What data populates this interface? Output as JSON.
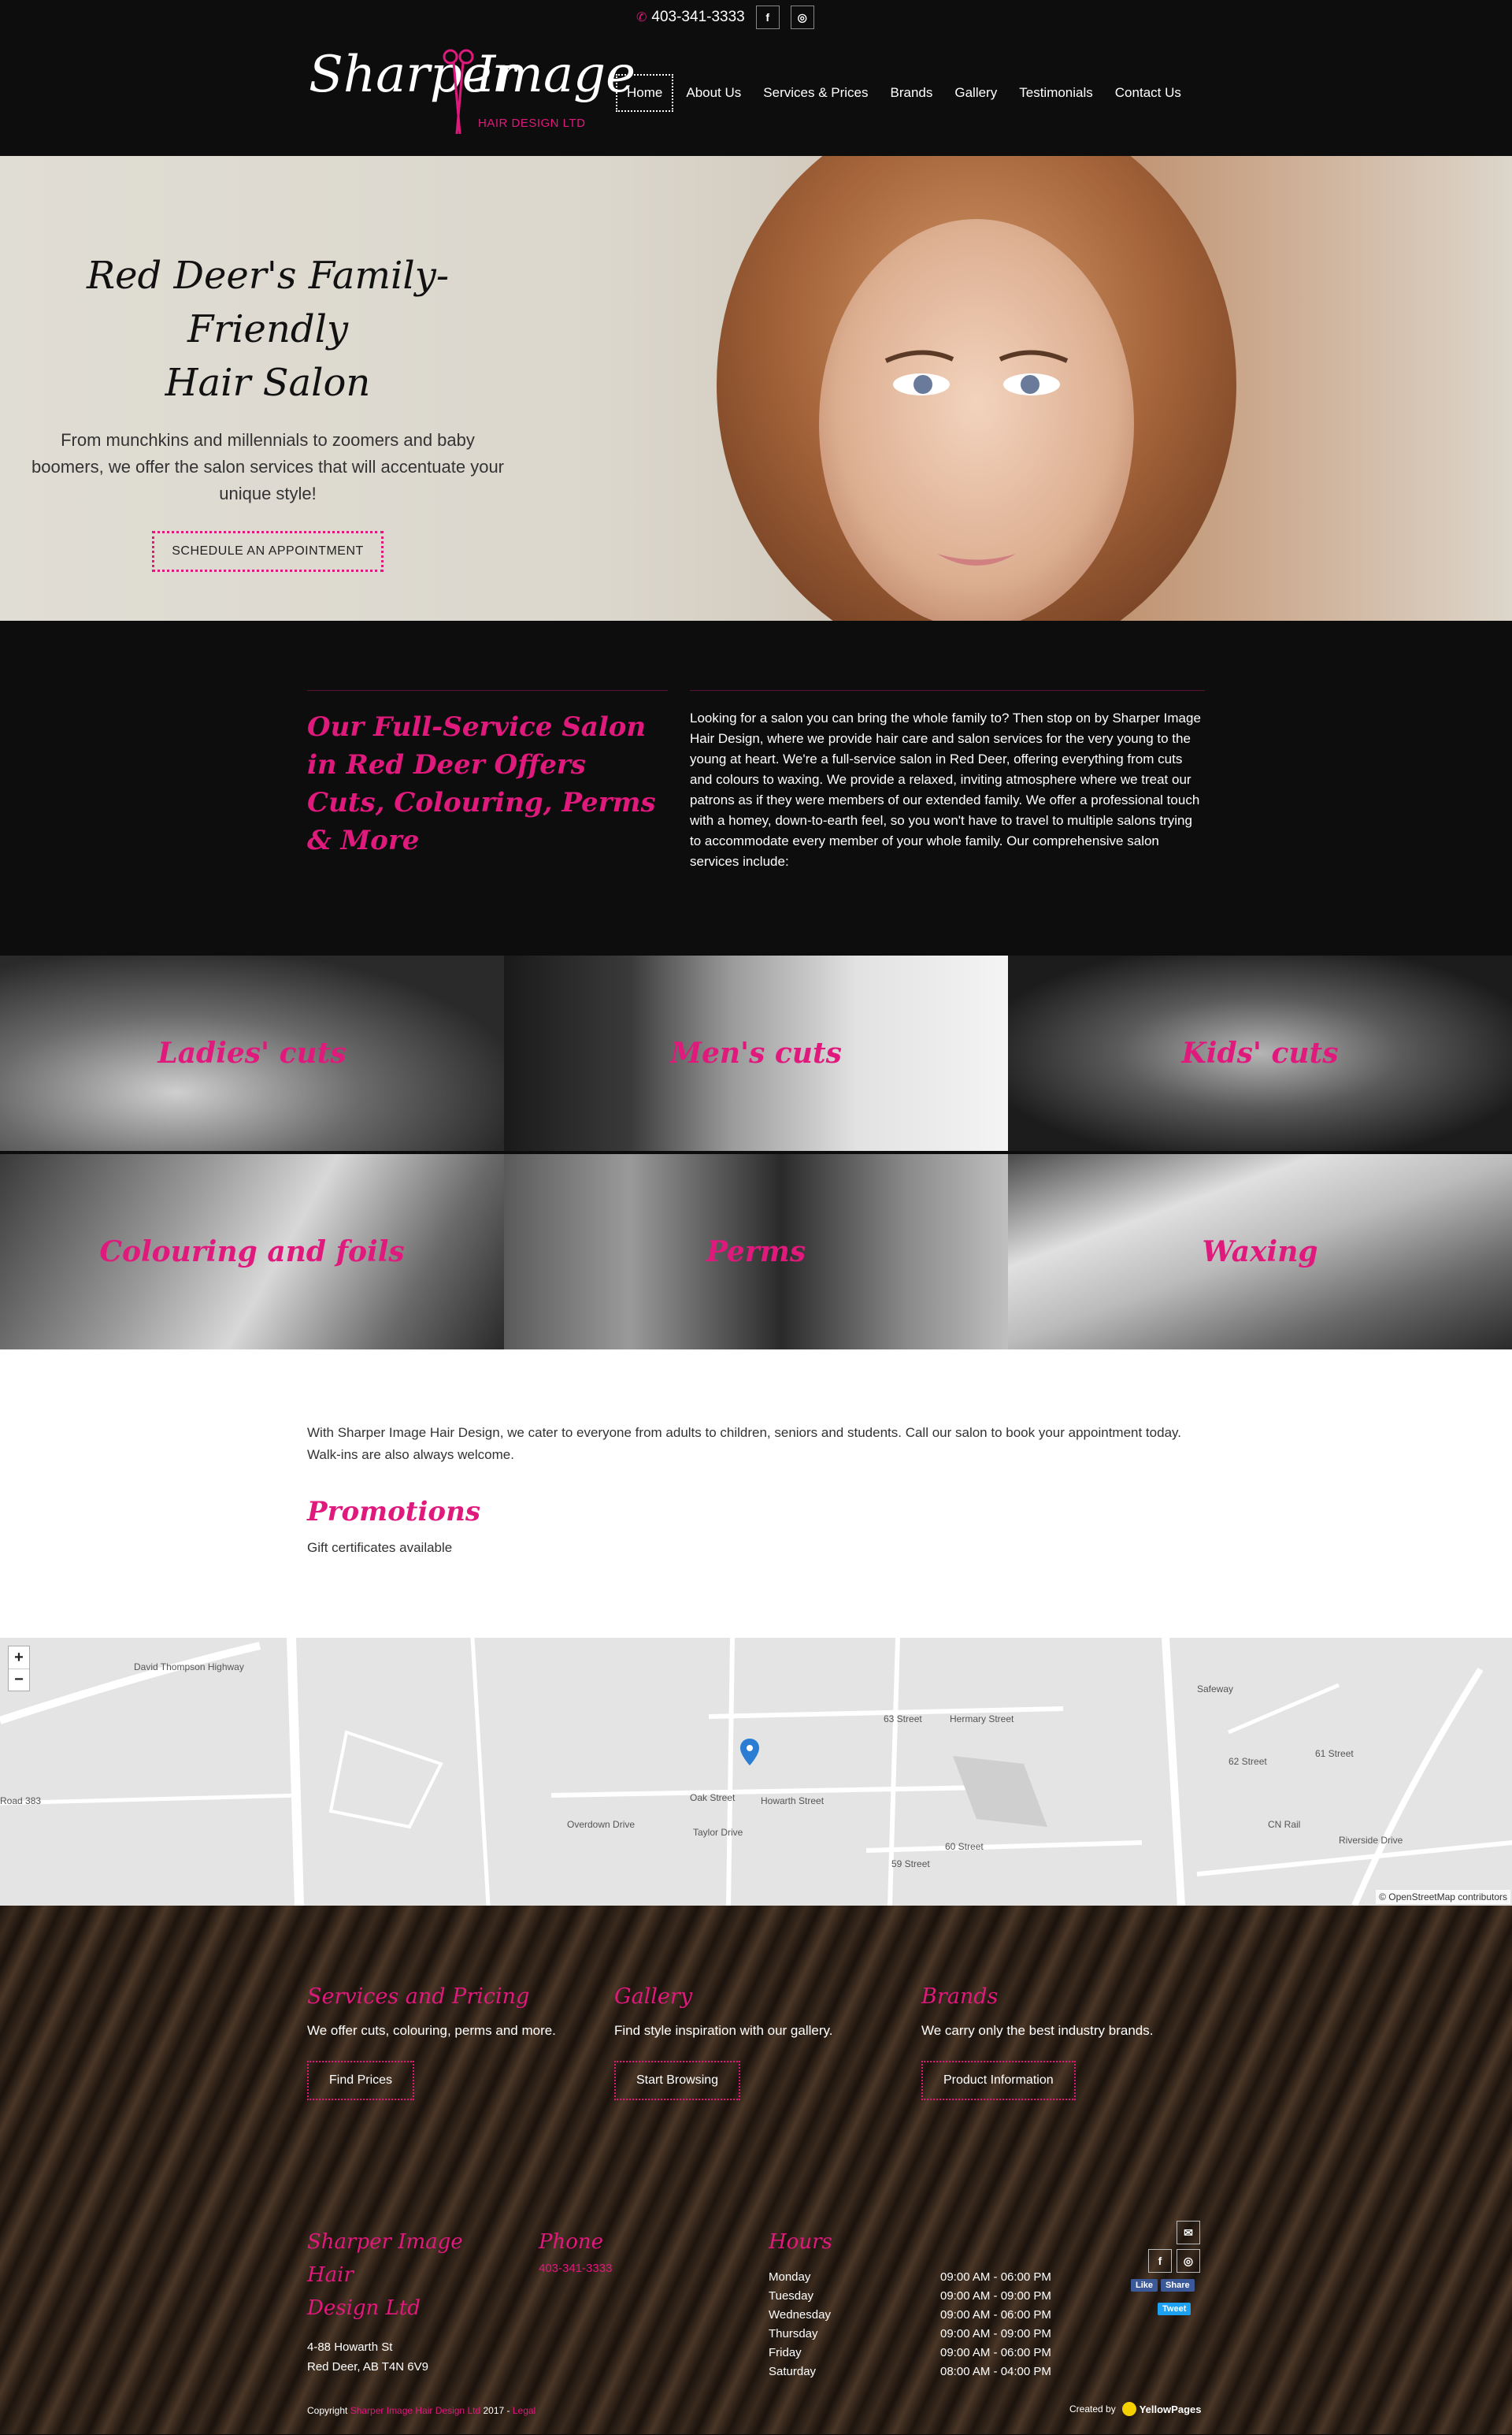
{
  "header": {
    "phone": "403-341-3333",
    "social": [
      "f",
      "◎"
    ],
    "logo_word_left": "Sharper",
    "logo_word_right": "Image",
    "logo_sub": "HAIR DESIGN LTD",
    "nav": [
      {
        "label": "Home",
        "active": true
      },
      {
        "label": "About Us"
      },
      {
        "label": "Services & Prices"
      },
      {
        "label": "Brands"
      },
      {
        "label": "Gallery"
      },
      {
        "label": "Testimonials"
      },
      {
        "label": "Contact Us"
      }
    ]
  },
  "hero": {
    "title_line1": "Red Deer's Family-Friendly",
    "title_line2": "Hair Salon",
    "subtitle": "From munchkins and millennials to zoomers and baby boomers, we offer the salon services that will accentuate your unique style!",
    "button": "SCHEDULE AN APPOINTMENT"
  },
  "intro": {
    "heading": "Our Full-Service Salon in Red Deer Offers Cuts, Colouring, Perms & More",
    "body": "Looking for a salon you can bring the whole family to? Then stop on by Sharper Image Hair Design, where we provide hair care and salon services for the very young to the young at heart. We're a full-service salon in Red Deer, offering everything from cuts and colours to waxing. We provide a relaxed, inviting atmosphere where we treat our patrons as if they were members of our extended family. We offer a professional touch with a homey, down-to-earth feel, so you won't have to travel to multiple salons trying to accommodate every member of your whole family. Our comprehensive salon services include:"
  },
  "services": [
    {
      "label": "Ladies' cuts"
    },
    {
      "label": "Men's cuts"
    },
    {
      "label": "Kids' cuts"
    },
    {
      "label": "Colouring and foils"
    },
    {
      "label": "Perms"
    },
    {
      "label": "Waxing"
    }
  ],
  "info": {
    "paragraph": "With Sharper Image Hair Design, we cater to everyone from adults to children, seniors and students. Call our salon to book your appointment today. Walk-ins are also always welcome.",
    "promotions_heading": "Promotions",
    "promotions_text": "Gift certificates available"
  },
  "map": {
    "zoom_in": "+",
    "zoom_out": "−",
    "attribution": "© OpenStreetMap contributors",
    "labels": [
      "Oak Street",
      "Howarth Street",
      "63 Street",
      "Hermary Street",
      "60 Street",
      "59 Street",
      "Taylor Drive",
      "Overdown Drive",
      "Road 383",
      "David Thompson Highway",
      "Safeway",
      "CN Rail",
      "Riverside Drive",
      "62 Street",
      "61 Street"
    ]
  },
  "cta": [
    {
      "title": "Services and Pricing",
      "text": "We offer cuts, colouring, perms and more.",
      "button": "Find Prices"
    },
    {
      "title": "Gallery",
      "text": "Find style inspiration with our gallery.",
      "button": "Start Browsing"
    },
    {
      "title": "Brands",
      "text": "We carry only the best industry brands.",
      "button": "Product Information"
    }
  ],
  "contact": {
    "name_line1": "Sharper Image Hair",
    "name_line2": "Design Ltd",
    "address_line1": "4-88 Howarth St",
    "address_line2": "Red Deer, AB T4N 6V9",
    "phone_heading": "Phone",
    "phone": "403-341-3333",
    "hours_heading": "Hours",
    "hours": [
      {
        "day": "Monday",
        "time": "09:00 AM - 06:00 PM"
      },
      {
        "day": "Tuesday",
        "time": "09:00 AM - 09:00 PM"
      },
      {
        "day": "Wednesday",
        "time": "09:00 AM - 06:00 PM"
      },
      {
        "day": "Thursday",
        "time": "09:00 AM - 09:00 PM"
      },
      {
        "day": "Friday",
        "time": "09:00 AM - 06:00 PM"
      },
      {
        "day": "Saturday",
        "time": "08:00 AM - 04:00 PM"
      }
    ],
    "like": "Like",
    "share": "Share",
    "tweet": "Tweet"
  },
  "footer": {
    "copyright_prefix": "Copyright",
    "copyright_name": "Sharper Image Hair Design Ltd",
    "copyright_year": "2017",
    "copyright_sep": " - ",
    "legal": "Legal",
    "created_by": "Created by",
    "yp": "YellowPages"
  },
  "colors": {
    "accent": "#e0197d",
    "dark": "#0d0d0d"
  }
}
